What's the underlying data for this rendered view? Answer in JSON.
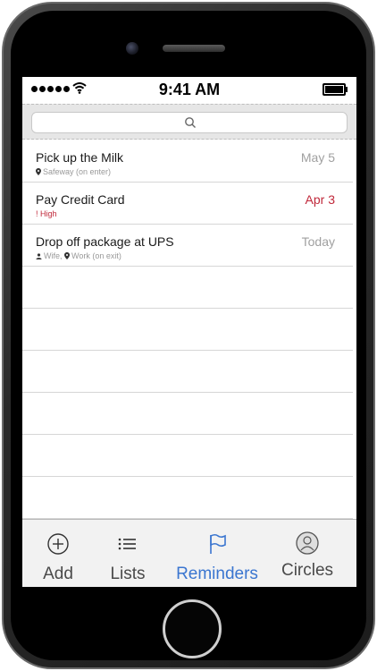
{
  "status_bar": {
    "time": "9:41 AM"
  },
  "search": {
    "icon": "search-icon"
  },
  "reminders": [
    {
      "title": "Pick up the Milk",
      "date": "May 5",
      "overdue": false,
      "meta_location": "Safeway (on enter)"
    },
    {
      "title": "Pay Credit Card",
      "date": "Apr 3",
      "overdue": true,
      "meta_priority": "! High"
    },
    {
      "title": "Drop off package at UPS",
      "date": "Today",
      "overdue": false,
      "meta_person": "Wife,",
      "meta_location": "Work (on exit)"
    }
  ],
  "tab_bar": {
    "tabs": [
      {
        "label": "Add",
        "icon": "plus-circle-icon",
        "active": false
      },
      {
        "label": "Lists",
        "icon": "list-icon",
        "active": false
      },
      {
        "label": "Reminders",
        "icon": "flag-icon",
        "active": true
      },
      {
        "label": "Circles",
        "icon": "person-circle-icon",
        "active": false
      }
    ]
  },
  "colors": {
    "accent": "#3b76d0",
    "overdue": "#c0283a",
    "muted": "#a0a0a0"
  }
}
